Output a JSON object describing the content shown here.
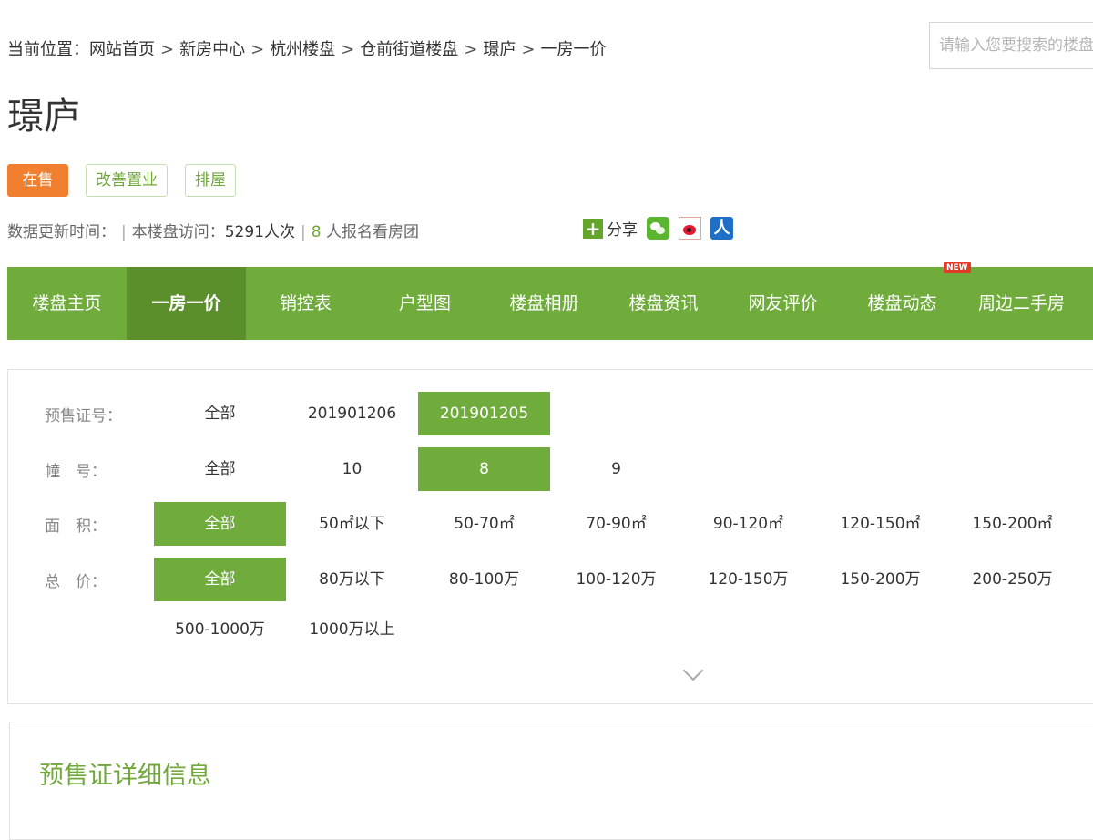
{
  "breadcrumb": {
    "prefix": "当前位置：",
    "items": [
      "网站首页",
      "新房中心",
      "杭州楼盘",
      "仓前街道楼盘",
      "璟庐",
      "一房一价"
    ]
  },
  "search": {
    "placeholder": "请输入您要搜索的楼盘"
  },
  "title": "璟庐",
  "tags": [
    {
      "label": "在售",
      "style": "on-sale"
    },
    {
      "label": "改善置业",
      "style": "outline"
    },
    {
      "label": "排屋",
      "style": "outline"
    }
  ],
  "stats": {
    "update_label": "数据更新时间：",
    "visits_label": "本楼盘访问：",
    "visits_count": "5291人次",
    "signup_count": "8",
    "signup_suffix": "人报名看房团"
  },
  "share": {
    "label": "分享",
    "icons": [
      "plus-icon",
      "wechat-icon",
      "weibo-icon",
      "renren-icon"
    ]
  },
  "nav": {
    "items": [
      "楼盘主页",
      "一房一价",
      "销控表",
      "户型图",
      "楼盘相册",
      "楼盘资讯",
      "网友评价",
      "楼盘动态",
      "周边二手房"
    ],
    "active_index": 1,
    "new_badge": "NEW"
  },
  "filters": {
    "cert": {
      "label": "预售证号：",
      "options": [
        "全部",
        "201901206",
        "201901205"
      ],
      "selected": 2
    },
    "building": {
      "label": "幢　号：",
      "options": [
        "全部",
        "10",
        "8",
        "9"
      ],
      "selected": 2
    },
    "area": {
      "label": "面　积：",
      "options": [
        "全部",
        "50㎡以下",
        "50-70㎡",
        "70-90㎡",
        "90-120㎡",
        "120-150㎡",
        "150-200㎡"
      ],
      "selected": 0
    },
    "price": {
      "label": "总　价：",
      "options": [
        "全部",
        "80万以下",
        "80-100万",
        "100-120万",
        "120-150万",
        "150-200万",
        "200-250万"
      ],
      "selected": 0,
      "more_options": [
        "500-1000万",
        "1000万以上"
      ]
    }
  },
  "detail": {
    "title": "预售证详细信息"
  },
  "colors": {
    "accent_green": "#70ac3c",
    "active_green": "#5b8f2b",
    "orange": "#f07f2f",
    "new_red": "#e03a2a"
  }
}
